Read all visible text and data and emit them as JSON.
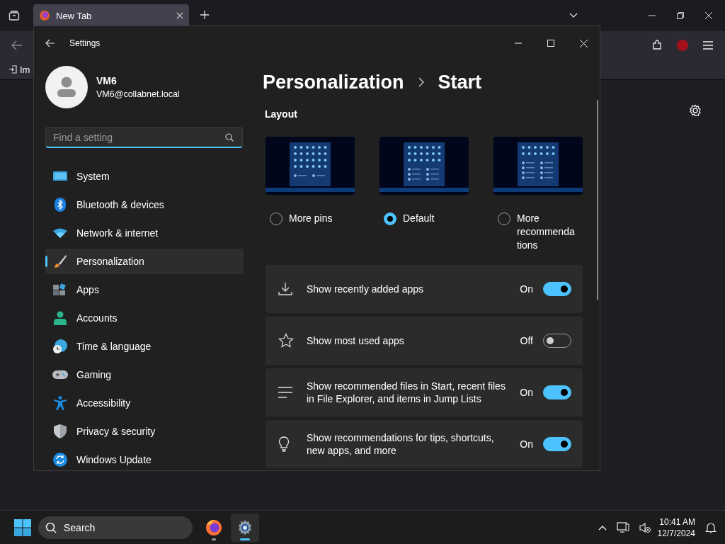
{
  "browser": {
    "tabs": [
      {
        "title": "New Tab",
        "selected": true
      }
    ],
    "bookmarks": [
      {
        "label": "Im"
      }
    ]
  },
  "settings": {
    "title": "Settings",
    "user": {
      "name": "VM6",
      "email": "VM6@collabnet.local"
    },
    "search": {
      "placeholder": "Find a setting"
    },
    "nav": [
      {
        "label": "System",
        "selected": false
      },
      {
        "label": "Bluetooth & devices",
        "selected": false
      },
      {
        "label": "Network & internet",
        "selected": false
      },
      {
        "label": "Personalization",
        "selected": true
      },
      {
        "label": "Apps",
        "selected": false
      },
      {
        "label": "Accounts",
        "selected": false
      },
      {
        "label": "Time & language",
        "selected": false
      },
      {
        "label": "Gaming",
        "selected": false
      },
      {
        "label": "Accessibility",
        "selected": false
      },
      {
        "label": "Privacy & security",
        "selected": false
      },
      {
        "label": "Windows Update",
        "selected": false
      }
    ],
    "breadcrumb": [
      "Personalization",
      "Start"
    ],
    "section": "Layout",
    "layouts": [
      {
        "kind": "pins",
        "label": "More pins",
        "selected": false
      },
      {
        "kind": "default",
        "label": "Default",
        "selected": true
      },
      {
        "kind": "recommendations",
        "label": "More recommendations",
        "selected": false
      }
    ],
    "toggles": [
      {
        "label": "Show recently added apps",
        "state": "On",
        "on": true
      },
      {
        "label": "Show most used apps",
        "state": "Off",
        "on": false
      },
      {
        "label": "Show recommended files in Start, recent files in File Explorer, and items in Jump Lists",
        "state": "On",
        "on": true
      },
      {
        "label": "Show recommendations for tips, shortcuts, new apps, and more",
        "state": "On",
        "on": true
      }
    ]
  },
  "taskbar": {
    "search": "Search",
    "apps": [
      {
        "kind": "firefox",
        "active": false
      },
      {
        "kind": "settings",
        "active": true
      }
    ],
    "time": "10:41 AM",
    "date": "12/7/2024"
  }
}
